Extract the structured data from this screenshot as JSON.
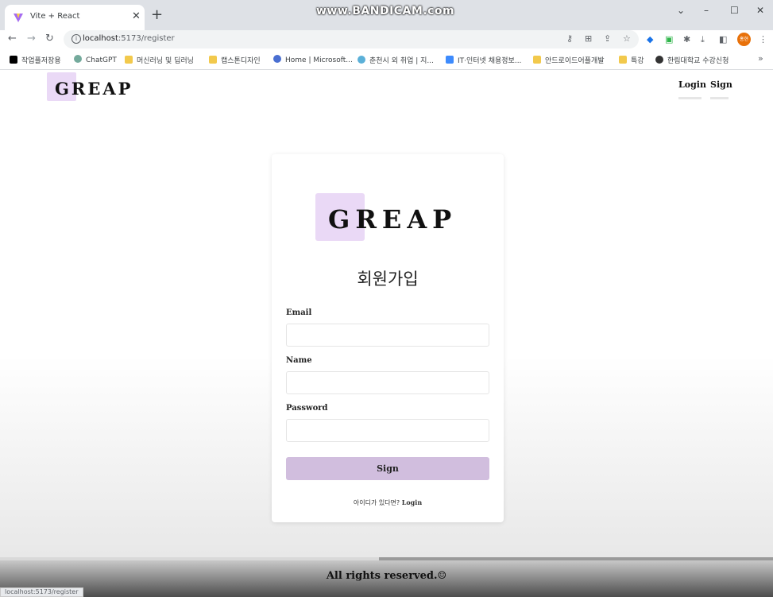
{
  "browser": {
    "tab_title": "Vite + React",
    "tab_close": "✕",
    "new_tab": "+",
    "watermark": "www.BANDICAM.com",
    "controls": {
      "chevron": "⌄",
      "minimize": "–",
      "maximize": "☐",
      "close": "✕"
    },
    "url_host": "localhost",
    "url_path": ":5173/register",
    "status_url": "localhost:5173/register",
    "avatar_text": "홍현"
  },
  "bookmarks": [
    {
      "label": "작업플저장용",
      "icon": "notion-icon",
      "color": "#000000"
    },
    {
      "label": "ChatGPT",
      "icon": "chatgpt-icon",
      "color": "#74aa9c"
    },
    {
      "label": "머신러닝 및 딥러닝",
      "icon": "folder-icon",
      "color": "#f2c94c"
    },
    {
      "label": "캡스톤디자인",
      "icon": "folder-icon",
      "color": "#f2c94c"
    },
    {
      "label": "Home | Microsoft...",
      "icon": "microsoft-icon",
      "color": "#4a6fd1"
    },
    {
      "label": "춘천시 외 취업 | 지...",
      "icon": "dots-icon",
      "color": "#5bb0d8"
    },
    {
      "label": "IT·인터넷 채용정보...",
      "icon": "job-icon",
      "color": "#3d8bfd"
    },
    {
      "label": "안드로이드어플개발",
      "icon": "folder-icon",
      "color": "#f2c94c"
    },
    {
      "label": "특강",
      "icon": "folder-icon",
      "color": "#f2c94c"
    },
    {
      "label": "한림대학교 수강신청",
      "icon": "globe-icon",
      "color": "#333333"
    }
  ],
  "bookmarks_more": "»",
  "header": {
    "logo": "GREAP",
    "nav": [
      "Login",
      "Sign"
    ]
  },
  "form": {
    "logo": "GREAP",
    "title": "회원가입",
    "fields": [
      {
        "label": "Email",
        "value": "",
        "placeholder": ""
      },
      {
        "label": "Name",
        "value": "",
        "placeholder": ""
      },
      {
        "label": "Password",
        "value": "",
        "placeholder": ""
      }
    ],
    "submit_label": "Sign",
    "footer_prompt": "아이디가 있다면?",
    "footer_link": "Login"
  },
  "video_progress": 0.49,
  "footer": {
    "text": "All rights reserved.☺"
  },
  "colors": {
    "logo_accent": "#ead9f6",
    "button": "#d1bede",
    "avatar": "#e8710a"
  }
}
